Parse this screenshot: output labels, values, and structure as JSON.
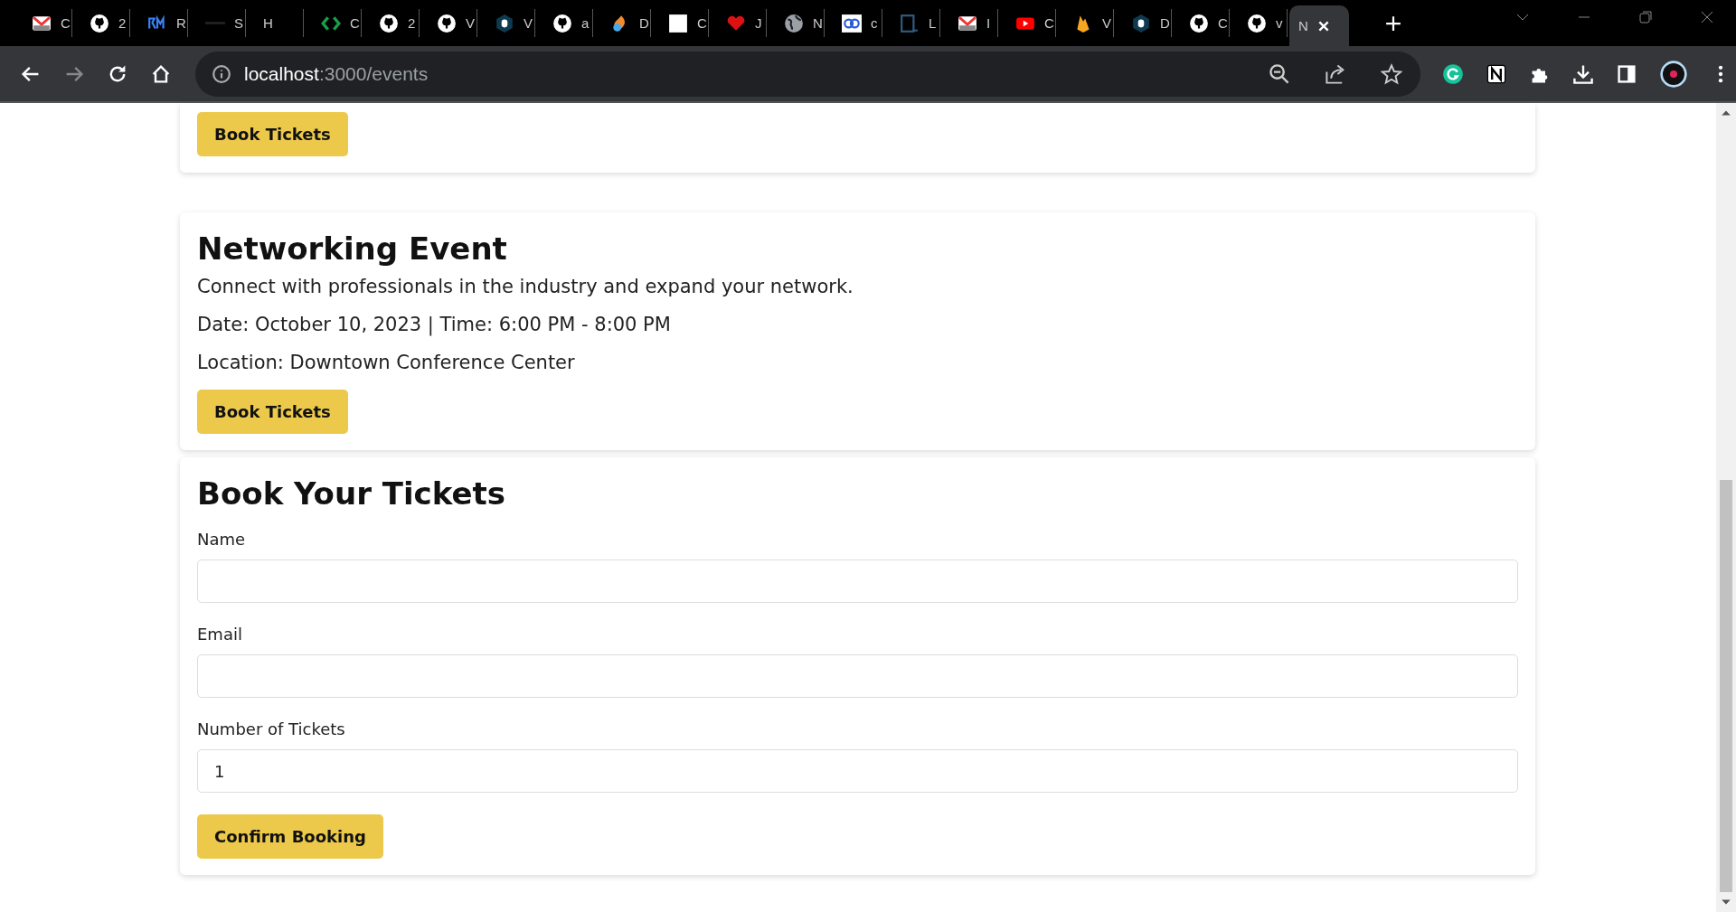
{
  "browser": {
    "tabs": [
      {
        "kind": "mail",
        "title": "C",
        "selected": false
      },
      {
        "kind": "github",
        "title": "2",
        "selected": false
      },
      {
        "kind": "logo",
        "title": "R",
        "selected": false
      },
      {
        "kind": "dash",
        "title": "S",
        "selected": false
      },
      {
        "kind": "none",
        "title": "H",
        "selected": false
      },
      {
        "kind": "code",
        "title": "C",
        "selected": false
      },
      {
        "kind": "github",
        "title": "2",
        "selected": false
      },
      {
        "kind": "github",
        "title": "V",
        "selected": false
      },
      {
        "kind": "hexagon",
        "title": "V",
        "selected": false
      },
      {
        "kind": "github",
        "title": "a",
        "selected": false
      },
      {
        "kind": "drop",
        "title": "D",
        "selected": false
      },
      {
        "kind": "square",
        "title": "C",
        "selected": false
      },
      {
        "kind": "heart",
        "title": "J",
        "selected": false
      },
      {
        "kind": "globe",
        "title": "N",
        "selected": false
      },
      {
        "kind": "link",
        "title": "c",
        "selected": false
      },
      {
        "kind": "terminal",
        "title": "L",
        "selected": false
      },
      {
        "kind": "mail",
        "title": "I",
        "selected": false
      },
      {
        "kind": "video",
        "title": "C",
        "selected": false
      },
      {
        "kind": "fire",
        "title": "V",
        "selected": false
      },
      {
        "kind": "hexagon",
        "title": "D",
        "selected": false
      },
      {
        "kind": "github",
        "title": "C",
        "selected": false
      },
      {
        "kind": "github",
        "title": "v",
        "selected": false
      },
      {
        "kind": "none",
        "title": "N",
        "selected": true
      }
    ],
    "address_bar": {
      "host": "localhost",
      "path": ":3000/events"
    }
  },
  "page": {
    "events": [
      {
        "button": "Book Tickets"
      },
      {
        "title": "Networking Event",
        "description": "Connect with professionals in the industry and expand your network.",
        "date": "Date: October 10, 2023 | Time: 6:00 PM - 8:00 PM",
        "location": "Location: Downtown Conference Center",
        "button": "Book Tickets"
      }
    ],
    "form": {
      "title": "Book Your Tickets",
      "fields": [
        {
          "label": "Name"
        },
        {
          "label": "Email"
        },
        {
          "label": "Number of Tickets",
          "value": "1"
        }
      ],
      "submit": "Confirm Booking"
    }
  }
}
